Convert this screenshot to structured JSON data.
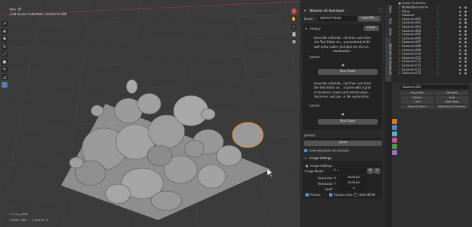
{
  "viewport": {
    "header_line1": "Ban. (f)",
    "header_line2": "(14) Scene Collection | Suzanne.024",
    "status_line1": "> run_code",
    "status_line2": "import bpy ... s_points_fr",
    "tools": [
      "cursor",
      "move",
      "rotate",
      "scale",
      "transform",
      "annotate",
      "measure",
      "add-cube"
    ]
  },
  "vtabs_left": [
    "Item",
    "Tool",
    "View",
    "Blender AI Assistant"
  ],
  "assistant": {
    "title": "Blender AI Assistant",
    "model_label": "Model:",
    "model_value": "opensai-large",
    "load_button": "Load Mo...",
    "history_title": "History",
    "clear_button": "Clear",
    "messages": [
      {
        "text": "Generate a Blende...ript then runs from\nthe Text Editor an... a procedural knife\nwall using cubes. Just give me the co...\nexplanation.",
        "code_label": "python",
        "run_label": "Run Code"
      },
      {
        "text": "Generate a Blende...ript then runs from\nthe Text Editor an... a plane with a grid\nof randomly scaled and rotated objec...\nSuzannes. Just giv...e. No explanation.",
        "code_label": "python",
        "run_label": "Run Code"
      }
    ],
    "prompt_label": "prompt:",
    "send_button": "Send",
    "status_text": "Code executed successfully.",
    "image_settings_section": "Image Settings",
    "image_settings_title": "Image Settings",
    "image_model_label": "Image Model:",
    "resolution_x_label": "Resolution X",
    "resolution_x_value": "1024 px",
    "resolution_y_label": "Resolution Y",
    "resolution_y_value": "1024 px",
    "seed_label": "Seed",
    "seed_value": "0",
    "private_label": "Private",
    "enhance_label": "Enhance Em...",
    "hide_label": "Hide NSFW"
  },
  "outliner": {
    "header": "Scene Collection",
    "rows": [
      "MyWallDirectional",
      "Plane",
      "Suzanne",
      "Suzanne.001",
      "Suzanne.002",
      "Suzanne.003",
      "Suzanne.004",
      "Suzanne.005",
      "Suzanne.006",
      "Suzanne.007",
      "Suzanne.008",
      "Suzanne.009",
      "Suzanne.010",
      "Suzanne.011",
      "Suzanne.012",
      "Suzanne.013",
      "Suzanne.014",
      "Suzanne.015"
    ]
  },
  "properties": {
    "object_name": "Suzanne.024",
    "physics_buttons": [
      [
        "Force Field",
        "Soft Body"
      ],
      [
        "Collision",
        "Fluid"
      ],
      [
        "Cloth",
        "Rigid Body"
      ],
      [
        "Dynamic Paint",
        "Rigid Body Constraint"
      ]
    ]
  },
  "colors": {
    "accent_blue": "#4a7fc9",
    "selection_orange": "#e38d2d",
    "button": "#545454"
  }
}
